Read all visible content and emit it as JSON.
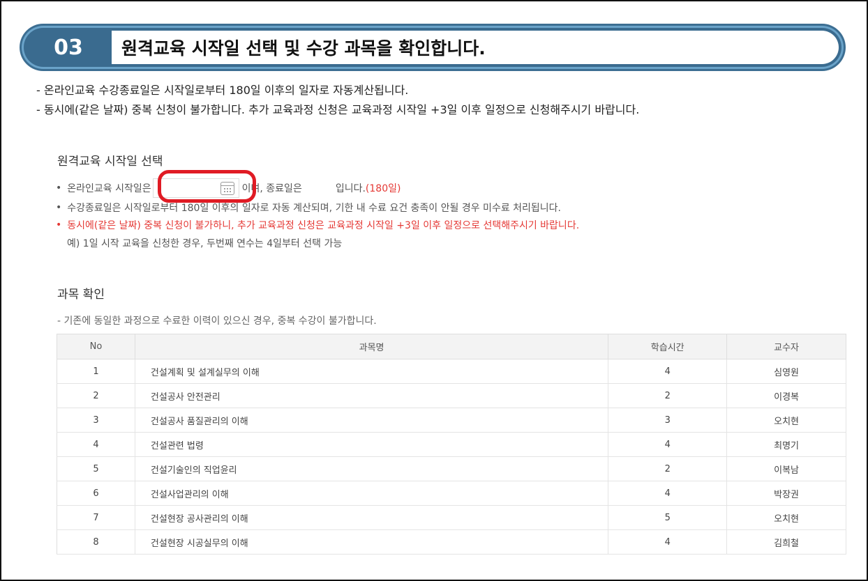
{
  "step": {
    "number": "03",
    "title": "원격교육 시작일 선택 및 수강 과목을 확인합니다."
  },
  "notices": [
    "- 온라인교육 수강종료일은 시작일로부터 180일 이후의 일자로 자동계산됩니다.",
    "- 동시에(같은 날짜) 중복 신청이 불가합니다. 추가 교육과정 신청은 교육과정 시작일 +3일 이후 일정으로 신청해주시기 바랍니다."
  ],
  "start_section": {
    "title": "원격교육 시작일 선택",
    "line1_prefix": "온라인교육 시작일은",
    "start_date_value": "",
    "line1_middle": "이며, 종료일은",
    "end_date_value": "",
    "line1_suffix": "입니다.",
    "days_label": "(180일)",
    "line2": "수강종료일은 시작일로부터 180일 이후의 일자로 자동 계산되며, 기한 내 수료 요건 충족이 안될 경우 미수료 처리됩니다.",
    "line3": "동시에(같은 날짜) 중복 신청이 불가하니, 추가 교육과정 신청은 교육과정 시작일 +3일 이후 일정으로 선택해주시기 바랍니다.",
    "line4": "예) 1일 시작 교육을 신청한 경우, 두번째 연수는 4일부터 선택 가능"
  },
  "course_section": {
    "title": "과목 확인",
    "note": "- 기존에 동일한 과정으로 수료한 이력이 있으신 경우, 중복 수강이 불가합니다.",
    "headers": [
      "No",
      "과목명",
      "학습시간",
      "교수자"
    ],
    "rows": [
      [
        "1",
        "건설계획 및 설계실무의 이해",
        "4",
        "심영원"
      ],
      [
        "2",
        "건설공사 안전관리",
        "2",
        "이경복"
      ],
      [
        "3",
        "건설공사 품질관리의 이해",
        "3",
        "오치현"
      ],
      [
        "4",
        "건설관련 법령",
        "4",
        "최명기"
      ],
      [
        "5",
        "건설기술인의 직업윤리",
        "2",
        "이복남"
      ],
      [
        "6",
        "건설사업관리의 이해",
        "4",
        "박장권"
      ],
      [
        "7",
        "건설현장 공사관리의 이해",
        "5",
        "오치현"
      ],
      [
        "8",
        "건설현장 시공실무의 이해",
        "4",
        "김희철"
      ]
    ]
  },
  "colors": {
    "header_blue": "#3a6b8f",
    "header_ring": "#6aa3c9",
    "highlight_red": "#e01b24",
    "warning_red": "#e53935"
  },
  "icons": {
    "calendar": "calendar-icon"
  }
}
